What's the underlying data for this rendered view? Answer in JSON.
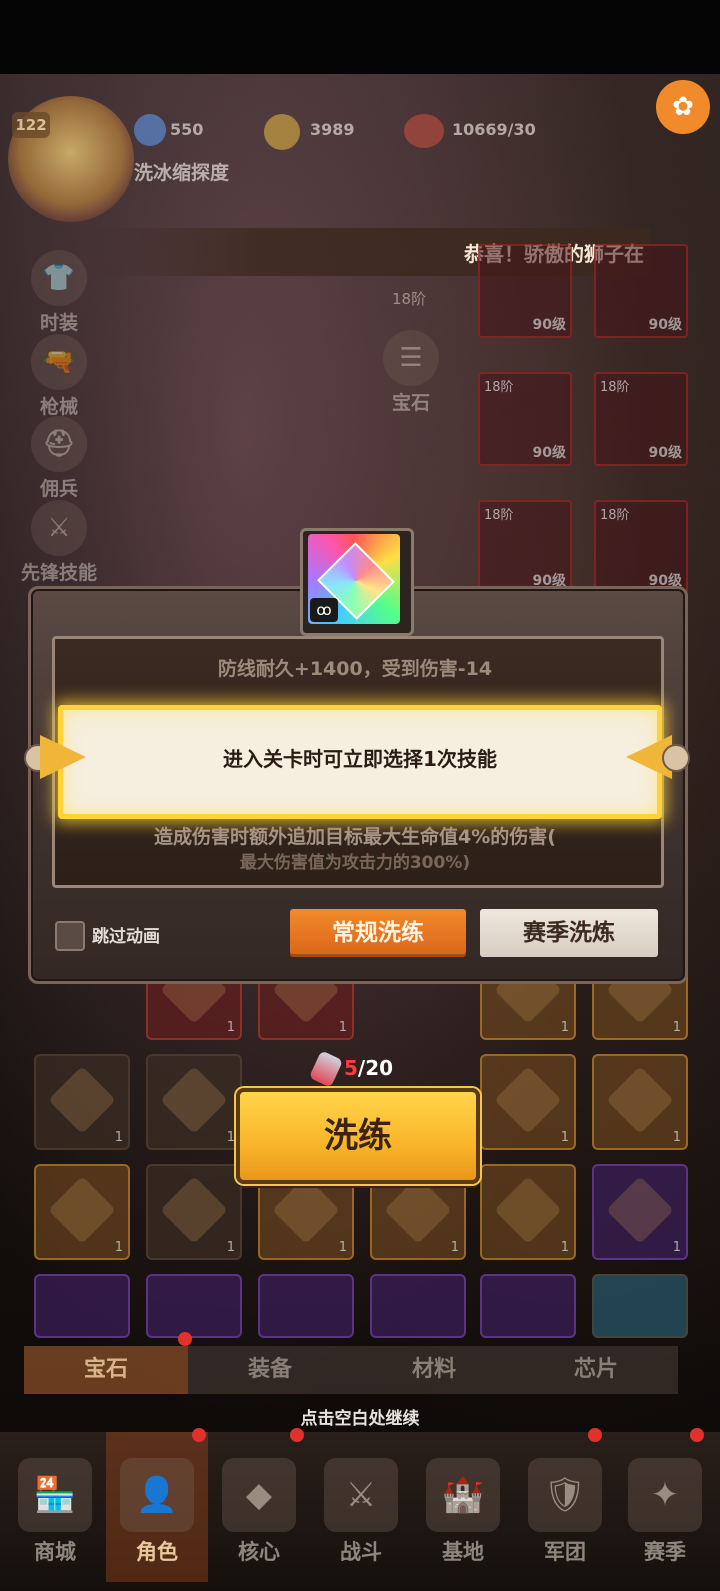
{
  "header": {
    "level": "122",
    "resources": [
      {
        "icon": "gem-plus-icon",
        "value": "550"
      },
      {
        "icon": "gold-coin-icon",
        "value": "3989"
      },
      {
        "icon": "meat-stamina-icon",
        "value": "10669/30"
      }
    ],
    "player_title": "洗冰缩探度"
  },
  "marquee": "恭喜！骄傲的狮子在",
  "side_menu": [
    {
      "label": "时装",
      "icon": "shirt-icon"
    },
    {
      "label": "枪械",
      "icon": "pistol-icon"
    },
    {
      "label": "佣兵",
      "icon": "mercenary-icon"
    },
    {
      "label": "先锋技能",
      "icon": "skill-icon"
    }
  ],
  "gem_shortcut": {
    "label": "宝石",
    "tier": "18阶"
  },
  "equipment": [
    {
      "tier": "",
      "level": "90级"
    },
    {
      "tier": "",
      "level": "90级"
    },
    {
      "tier": "18阶",
      "level": "90级"
    },
    {
      "tier": "18阶",
      "level": "90级"
    },
    {
      "tier": "18阶",
      "level": "90级"
    },
    {
      "tier": "18阶",
      "level": "90级"
    }
  ],
  "modal": {
    "prev_attr": "防线耐久+1400，受到伤害-14",
    "current_attr": "进入关卡时可立即选择1次技能",
    "next_attr": "造成伤害时额外追加目标最大生命值4%的伤害(",
    "next_attr_2": "最大伤害值为攻击力的300%)",
    "skip_label": "跳过动画",
    "tabs": {
      "regular": "常规洗练",
      "season": "赛季洗炼"
    },
    "gem_badge": "ꝏ"
  },
  "refine": {
    "current": "5",
    "total": "/20",
    "button": "洗练"
  },
  "inventory_tabs": [
    "宝石",
    "装备",
    "材料",
    "芯片"
  ],
  "gem_counts": [
    "1",
    "1",
    "1",
    "1",
    "1",
    "1",
    "1",
    "1",
    "1",
    "1",
    "1",
    "1",
    "1",
    "1",
    "1",
    "1",
    "1",
    "1"
  ],
  "hint": "点击空白处继续",
  "bottom_nav": [
    {
      "label": "商城",
      "icon": "shop-icon"
    },
    {
      "label": "角色",
      "icon": "character-icon"
    },
    {
      "label": "核心",
      "icon": "core-icon"
    },
    {
      "label": "战斗",
      "icon": "battle-icon"
    },
    {
      "label": "基地",
      "icon": "base-icon"
    },
    {
      "label": "军团",
      "icon": "legion-icon"
    },
    {
      "label": "赛季",
      "icon": "season-icon"
    }
  ]
}
